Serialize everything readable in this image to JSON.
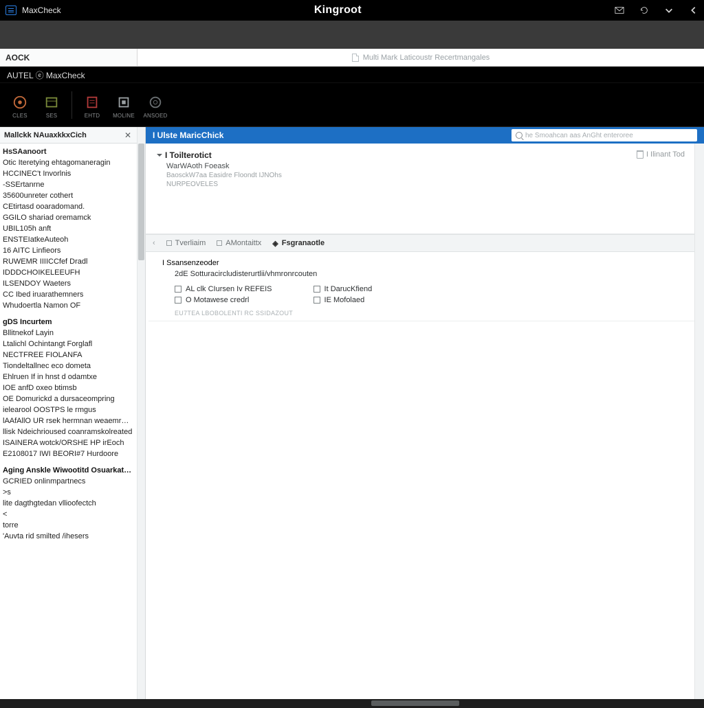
{
  "titlebar": {
    "tab_title": "MaxCheck",
    "app_title": "Kingroot"
  },
  "tabstrip": {
    "left_tab": "AOCK",
    "main_tab": "Multi Mark Laticoustr Recertmangales"
  },
  "brand": "AUTEL ⓔ MaxCheck",
  "ribbon": {
    "b1": "CLES",
    "b2": "SES",
    "b3": "EHTD",
    "b4": "MOLINE",
    "b5": "ANSOED"
  },
  "sidebar": {
    "title": "Mallckk NAuaxkkxCich",
    "groups": [
      {
        "heading": "HsSAanoort",
        "items": [
          "Otic Iteretying ehtagomaneragin",
          "HCCINEC't Invorlnis",
          "-SSErtanrne",
          "35600unreter cothert",
          "CEtirtasd ooaradomand.",
          "GGILO shariad oremamck",
          "UBIL105h anft",
          "ENSTEIatkeAuteoh",
          "16 AITC Linfieors",
          "RUWEMR IIIICCfef Dradl",
          "IDDDCHOIKELEEUFH",
          "ILSENDOY Waeters",
          "CC Ibed iruarathemners",
          "Whudoertla Namon OF"
        ]
      },
      {
        "heading": "gDS Incurtem",
        "items": [
          "Bllitnekof Layin",
          "Ltalichl Ochintangt Forglafl",
          "NECTFREE FIOLANFA",
          "Tiondeltallnec eco dometa",
          "Ehlruen If in hnst d odamtxe",
          "IOE anfD oxeo btimsb",
          "OE Domurickd a dursaceompring",
          "ielearool OOSTPS le rmgus",
          "lAAfAllO UR rsek hermnan weaemreadton",
          "llisk Ndeichrioused coanramskolreated",
          "ISAINERA wotck/ORSHE HP irEoch",
          "E2108017 IWI BEORI#7 Hurdoore"
        ]
      },
      {
        "heading": "Aging Anskle Wiwootitd Osuarkatuterl",
        "items": [
          "GCRIED onlinmpartnecs",
          ">s",
          "lite dagthgtedan vllioofectch",
          "<",
          "torre",
          "'Auvta rid smilted /ihesers"
        ]
      }
    ]
  },
  "bluebar": {
    "title": "I Ulste MaricChick",
    "placeholder": "he Smoahcan aas AnGht enteroree"
  },
  "card1": {
    "title": "I Toilterotict",
    "sub": "WarWAoth Foeask",
    "meta": "BaosckW7aa Easidre Floondt IJNOhs",
    "meta2": "NURPEOVELES",
    "tool": "I Ilinant Tod"
  },
  "breadcrumb": {
    "i1": "Tverliaim",
    "i2": "AMontaittx",
    "i3": "Fsgranaotle"
  },
  "props": {
    "title": "I Ssansenzeoder",
    "desc": "2dE Sotturacircludisterurtlii/vhmronrcouten",
    "col1": [
      "AL clk CIursen Iv REFEIS",
      "O Motawese credrl"
    ],
    "col2": [
      "It DarucKfiend",
      "IE Mofolaed"
    ],
    "mid": "EU7TEA LBOBOLENTI RC SSIDAZOUT"
  }
}
